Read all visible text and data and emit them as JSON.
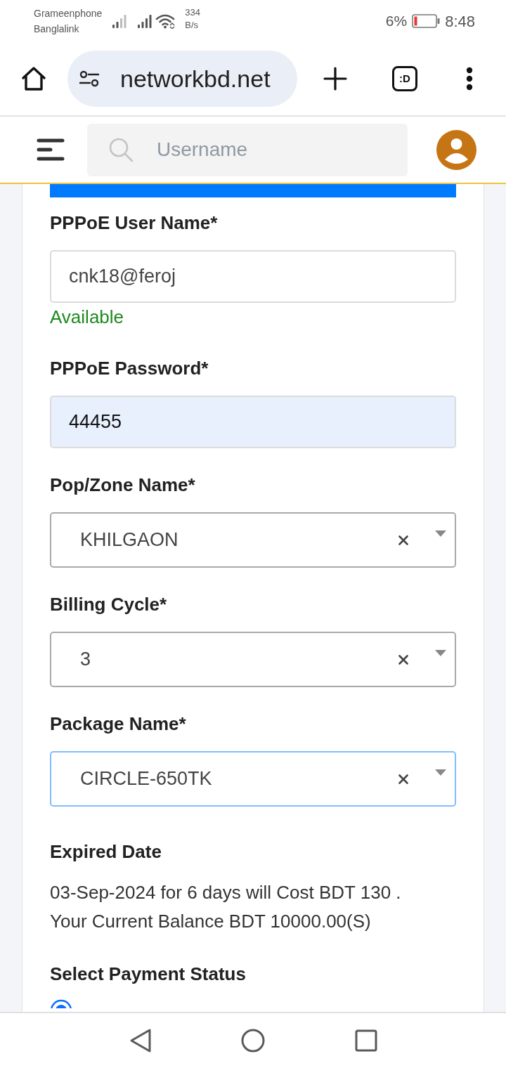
{
  "status_bar": {
    "carriers": [
      "Grameenphone",
      "Banglalink"
    ],
    "net_speed": [
      "334",
      "B/s"
    ],
    "battery_percent": "6%",
    "time": "8:48"
  },
  "browser": {
    "url": "networkbd.net",
    "tab_switcher": ":D"
  },
  "app_header": {
    "search": {
      "placeholder": "Username"
    }
  },
  "form": {
    "fields": [
      {
        "kind": "text",
        "label": "PPPoE User Name*",
        "value": "cnk18@feroj",
        "status": "Available",
        "autofilled": false,
        "focused": false
      },
      {
        "kind": "text",
        "label": "PPPoE Password*",
        "value": "44455",
        "autofilled": true,
        "focused": false
      },
      {
        "kind": "select",
        "label": "Pop/Zone Name*",
        "value": "KHILGAON",
        "autofilled": false,
        "focused": false
      },
      {
        "kind": "select",
        "label": "Billing Cycle*",
        "value": "3",
        "autofilled": false,
        "focused": false
      },
      {
        "kind": "select",
        "label": "Package Name*",
        "value": "CIRCLE-650TK",
        "autofilled": false,
        "focused": true
      }
    ],
    "expired_date": {
      "label": "Expired Date",
      "lines": [
        "03-Sep-2024 for 6 days will Cost BDT 130 .",
        "Your Current Balance BDT 10000.00(S)"
      ]
    },
    "payment_status": {
      "label": "Select Payment Status",
      "options": [
        {
          "selected": true
        }
      ]
    }
  }
}
